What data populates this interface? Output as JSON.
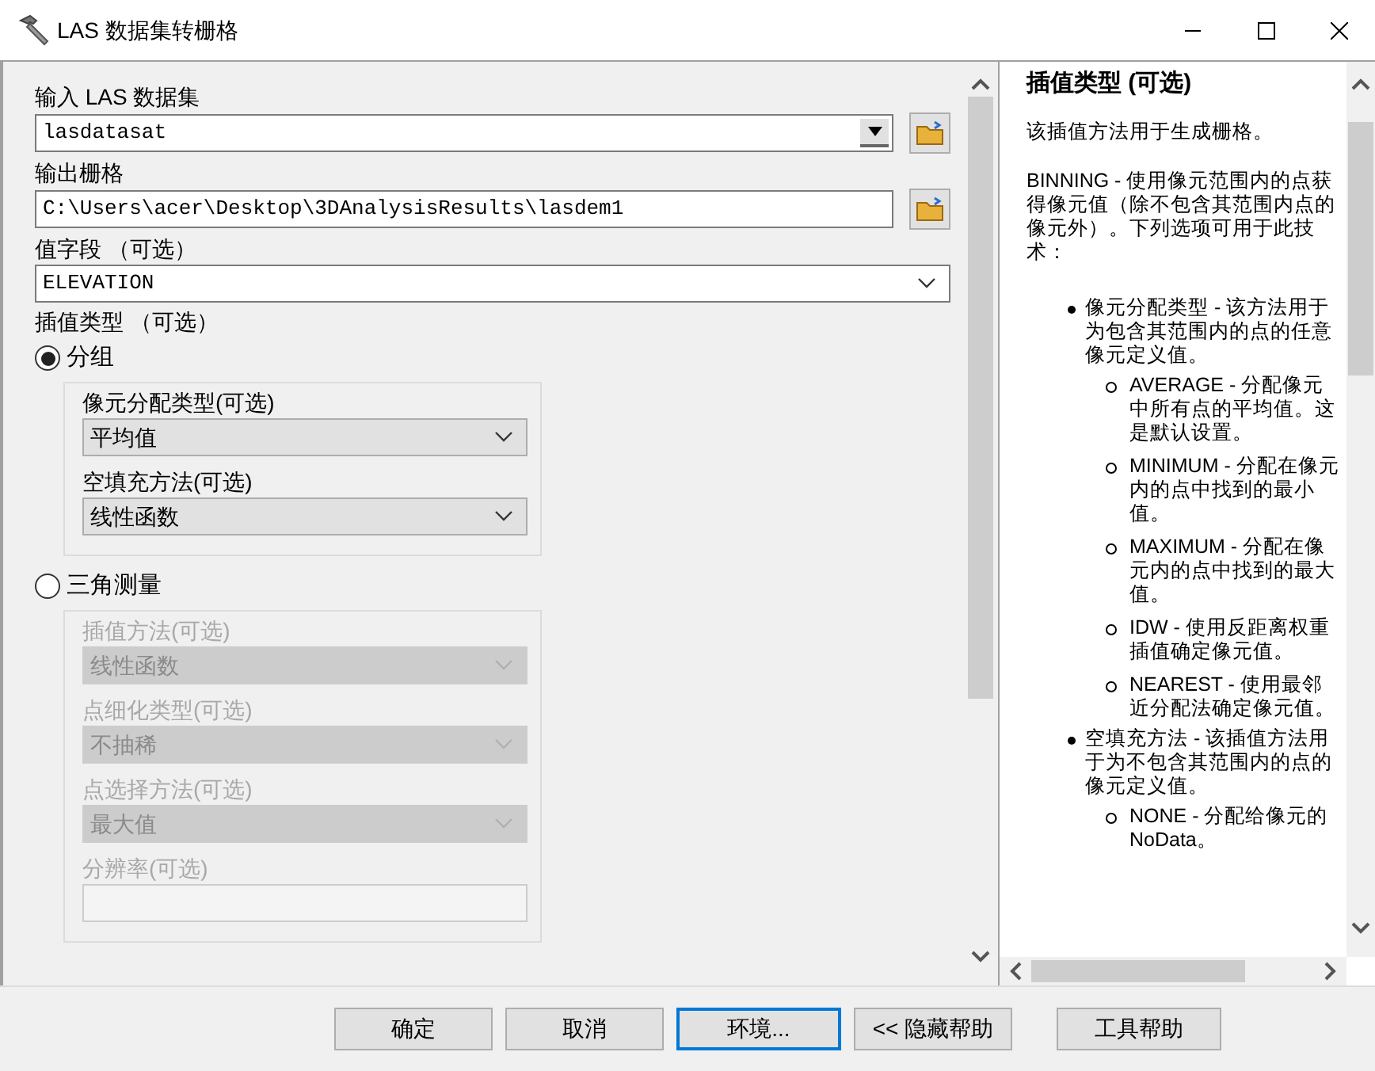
{
  "window": {
    "title": "LAS 数据集转栅格"
  },
  "fields": [
    {
      "kind": "combo",
      "label": "输入 LAS 数据集",
      "value": "lasdatasat",
      "browse": true
    },
    {
      "kind": "text",
      "label": "输出栅格",
      "value": "C:\\Users\\acer\\Desktop\\3DAnalysisResults\\lasdem1",
      "browse": true
    },
    {
      "kind": "select",
      "label": "值字段 （可选）",
      "value": "ELEVATION",
      "browse": false
    }
  ],
  "interpolation": {
    "label": "插值类型 （可选）",
    "options": [
      {
        "label": "分组",
        "selected": true,
        "fields": [
          {
            "kind": "select",
            "label": "像元分配类型(可选)",
            "value": "平均值",
            "disabled": false
          },
          {
            "kind": "select",
            "label": "空填充方法(可选)",
            "value": "线性函数",
            "disabled": false
          }
        ]
      },
      {
        "label": "三角测量",
        "selected": false,
        "fields": [
          {
            "kind": "select",
            "label": "插值方法(可选)",
            "value": "线性函数",
            "disabled": true
          },
          {
            "kind": "select",
            "label": "点细化类型(可选)",
            "value": "不抽稀",
            "disabled": true
          },
          {
            "kind": "select",
            "label": "点选择方法(可选)",
            "value": "最大值",
            "disabled": true
          },
          {
            "kind": "text",
            "label": "分辨率(可选)",
            "disabled": true
          }
        ]
      }
    ]
  },
  "help": {
    "title": "插值类型 (可选)",
    "paragraphs": [
      "该插值方法用于生成栅格。",
      "BINNING - 使用像元范围内的点获得像元值（除不包含其范围内点的像元外）。下列选项可用于此技术："
    ],
    "bullets": [
      {
        "text": "像元分配类型 - 该方法用于为包含其范围内的点的任意像元定义值。",
        "children": [
          {
            "text": "AVERAGE - 分配像元中所有点的平均值。这是默认设置。"
          },
          {
            "text": "MINIMUM - 分配在像元内的点中找到的最小值。"
          },
          {
            "text": "MAXIMUM - 分配在像元内的点中找到的最大值。"
          },
          {
            "text": "IDW - 使用反距离权重插值确定像元值。"
          },
          {
            "text": "NEAREST - 使用最邻近分配法确定像元值。"
          }
        ]
      },
      {
        "text": "空填充方法 - 该插值方法用于为不包含其范围内的点的像元定义值。",
        "children": [
          {
            "text": "NONE - 分配给像元的 NoData。"
          }
        ]
      }
    ]
  },
  "buttons": [
    {
      "label": "确定",
      "focused": false
    },
    {
      "label": "取消",
      "focused": false
    },
    {
      "label": "环境...",
      "focused": true
    },
    {
      "label": "<< 隐藏帮助",
      "focused": false
    },
    {
      "label": "工具帮助",
      "focused": false
    }
  ]
}
